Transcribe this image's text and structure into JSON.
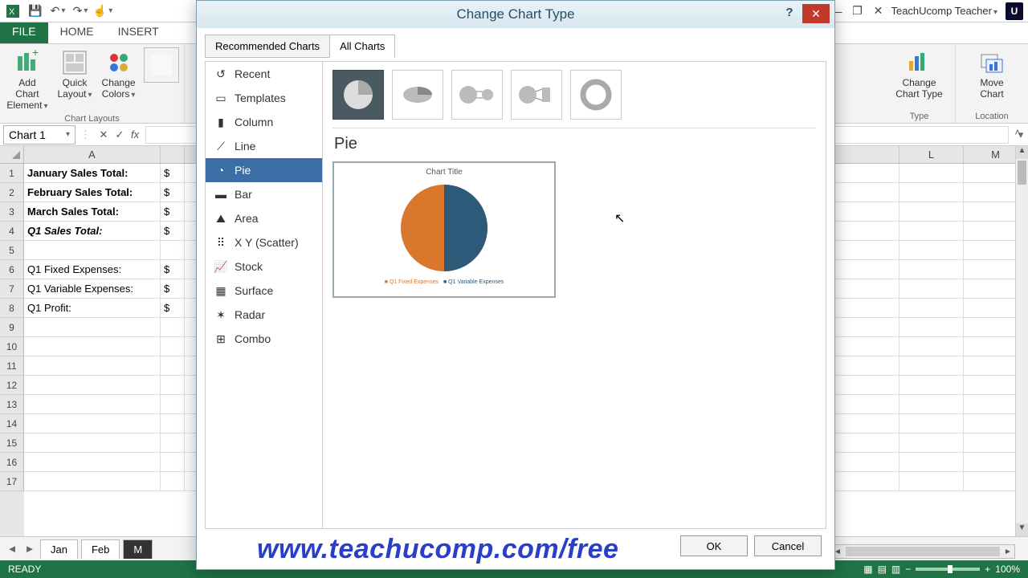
{
  "qat": {
    "account": "TeachUcomp Teacher",
    "brand_letter": "U"
  },
  "ribbon_tabs": {
    "file": "FILE",
    "home": "HOME",
    "insert": "INSERT"
  },
  "ribbon": {
    "chart_layouts_group": "Chart Layouts",
    "add_chart_element": "Add Chart\nElement",
    "quick_layout": "Quick\nLayout",
    "change_colors": "Change\nColors",
    "type_group": "Type",
    "change_chart_type": "Change\nChart Type",
    "location_group": "Location",
    "move_chart": "Move\nChart"
  },
  "name_box": "Chart 1",
  "fx": "fx",
  "columns": {
    "A": "A",
    "B": "$",
    "L": "L",
    "M": "M"
  },
  "rows": [
    {
      "a": "January Sales Total:",
      "b": "$",
      "bold": true
    },
    {
      "a": "February Sales Total:",
      "b": "$",
      "bold": true
    },
    {
      "a": "March Sales Total:",
      "b": "$",
      "bold": true
    },
    {
      "a": "Q1 Sales Total:",
      "b": "$",
      "bold": true,
      "italic": true
    },
    {
      "a": "",
      "b": ""
    },
    {
      "a": "Q1 Fixed Expenses:",
      "b": "$"
    },
    {
      "a": "Q1 Variable Expenses:",
      "b": "$"
    },
    {
      "a": "Q1 Profit:",
      "b": "$"
    },
    {
      "a": "",
      "b": ""
    },
    {
      "a": "",
      "b": ""
    },
    {
      "a": "",
      "b": ""
    },
    {
      "a": "",
      "b": ""
    },
    {
      "a": "",
      "b": ""
    },
    {
      "a": "",
      "b": ""
    },
    {
      "a": "",
      "b": ""
    },
    {
      "a": "",
      "b": ""
    },
    {
      "a": "",
      "b": ""
    }
  ],
  "sheets": {
    "jan": "Jan",
    "feb": "Feb",
    "mar": "M"
  },
  "status": {
    "ready": "READY",
    "zoom": "100%"
  },
  "dialog": {
    "title": "Change Chart Type",
    "tabs": {
      "recommended": "Recommended Charts",
      "all": "All Charts"
    },
    "sidebar": [
      "Recent",
      "Templates",
      "Column",
      "Line",
      "Pie",
      "Bar",
      "Area",
      "X Y (Scatter)",
      "Stock",
      "Surface",
      "Radar",
      "Combo"
    ],
    "selected_sidebar_index": 4,
    "chart_name": "Pie",
    "preview_title": "Chart Title",
    "legend_a": "Q1 Fixed Expenses",
    "legend_b": "Q1 Variable Expenses",
    "ok": "OK",
    "cancel": "Cancel"
  },
  "watermark": "www.teachucomp.com/free",
  "chart_data": {
    "type": "pie",
    "title": "Chart Title",
    "categories": [
      "Q1 Fixed Expenses",
      "Q1 Variable Expenses"
    ],
    "values": [
      50,
      50
    ],
    "colors": [
      "#d9782d",
      "#2e5a7a"
    ],
    "legend_position": "bottom"
  }
}
